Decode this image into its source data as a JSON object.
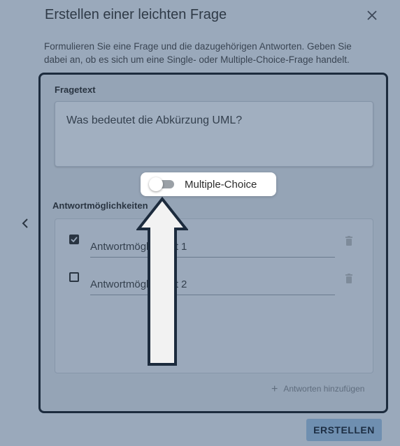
{
  "dialog": {
    "title": "Erstellen einer leichten Frage",
    "description": "Formulieren Sie eine Frage und die dazugehörigen Antworten. Geben Sie dabei an, ob es sich um eine Single- oder Multiple-Choice-Frage handelt.",
    "close_icon": "close-icon",
    "back_icon": "chevron-left-icon"
  },
  "question": {
    "label": "Fragetext",
    "value": "Was bedeutet die Abkürzung UML?"
  },
  "toggle": {
    "label": "Multiple-Choice",
    "on": false
  },
  "answers": {
    "label": "Antwortmöglichkeiten",
    "items": [
      {
        "text": "Antwortmöglichkeit 1",
        "checked": true
      },
      {
        "text": "Antwortmöglichkeit 2",
        "checked": false
      }
    ],
    "add_label": "Antworten hinzufügen"
  },
  "footer": {
    "create_label": "ERSTELLEN"
  },
  "colors": {
    "overlay": "#9aa9bb",
    "panel_border": "#1c2b3d",
    "button": "#6f8fb0",
    "arrow_fill": "#f2f2f2",
    "arrow_stroke": "#1c2b3d"
  }
}
